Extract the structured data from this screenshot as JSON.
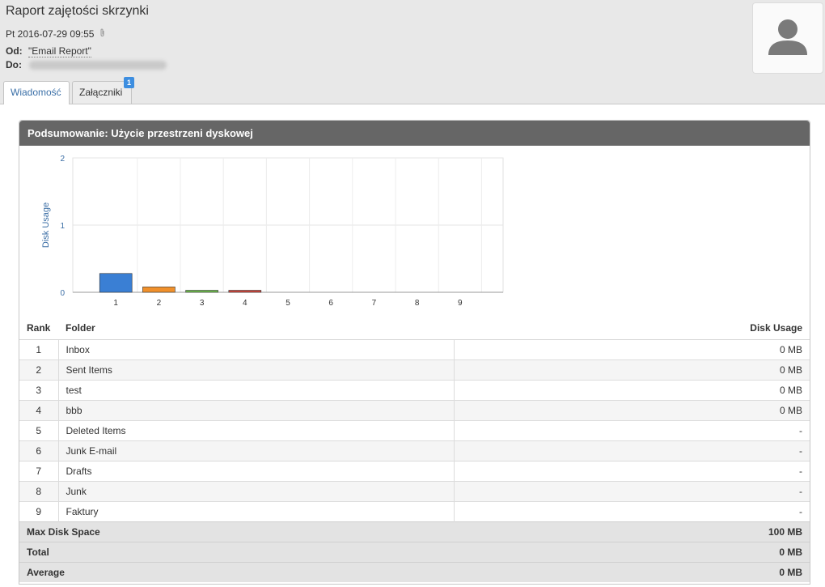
{
  "message": {
    "subject": "Raport zajętości skrzynki",
    "date": "Pt 2016-07-29 09:55",
    "from_label": "Od:",
    "from_value": "\"Email Report\"",
    "to_label": "Do:"
  },
  "tabs": [
    {
      "label": "Wiadomość",
      "active": true
    },
    {
      "label": "Załączniki",
      "badge": "1"
    }
  ],
  "panel": {
    "title": "Podsumowanie: Użycie przestrzeni dyskowej"
  },
  "chart_data": {
    "type": "bar",
    "categories": [
      "1",
      "2",
      "3",
      "4",
      "5",
      "6",
      "7",
      "8",
      "9"
    ],
    "values": [
      0.28,
      0.08,
      0.03,
      0.03,
      0,
      0,
      0,
      0,
      0
    ],
    "colors": [
      "#3a7fd4",
      "#f0902b",
      "#6dbb4a",
      "#d0453b",
      "#8f6bc2",
      "#888888",
      "#888888",
      "#888888",
      "#888888"
    ],
    "ylabel": "Disk Usage",
    "xlabel": "",
    "ylim": [
      0,
      2
    ],
    "yticks": [
      "0",
      "1",
      "2"
    ],
    "grid": true
  },
  "table": {
    "headers": {
      "rank": "Rank",
      "folder": "Folder",
      "usage": "Disk Usage"
    },
    "rows": [
      {
        "rank": "1",
        "folder": "Inbox",
        "usage": "0 MB"
      },
      {
        "rank": "2",
        "folder": "Sent Items",
        "usage": "0 MB"
      },
      {
        "rank": "3",
        "folder": "test",
        "usage": "0 MB"
      },
      {
        "rank": "4",
        "folder": "bbb",
        "usage": "0 MB"
      },
      {
        "rank": "5",
        "folder": "Deleted Items",
        "usage": "-"
      },
      {
        "rank": "6",
        "folder": "Junk E-mail",
        "usage": "-"
      },
      {
        "rank": "7",
        "folder": "Drafts",
        "usage": "-"
      },
      {
        "rank": "8",
        "folder": "Junk",
        "usage": "-"
      },
      {
        "rank": "9",
        "folder": "Faktury",
        "usage": "-"
      }
    ],
    "summary": [
      {
        "label": "Max Disk Space",
        "value": "100 MB"
      },
      {
        "label": "Total",
        "value": "0 MB"
      },
      {
        "label": "Average",
        "value": "0 MB"
      }
    ]
  }
}
